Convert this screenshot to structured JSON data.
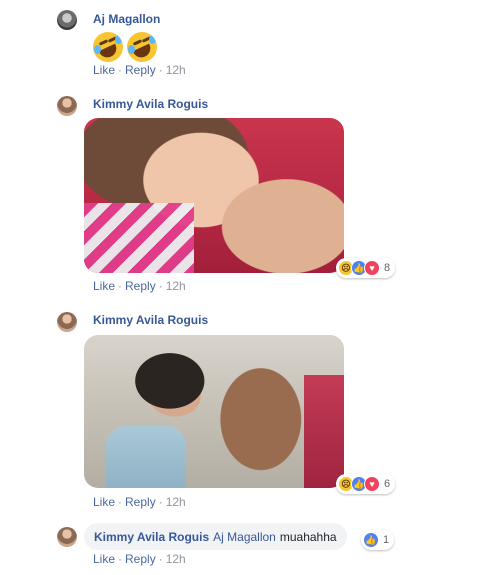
{
  "comments": [
    {
      "author": "Aj Magallon",
      "emojis": [
        "rolling-on-floor-laughing",
        "rolling-on-floor-laughing"
      ],
      "like": "Like",
      "reply": "Reply",
      "time": "12h"
    },
    {
      "author": "Kimmy Avila Roguis",
      "photo": "selfie-photo-1",
      "reactions": [
        "sad",
        "like",
        "love"
      ],
      "reaction_count": "8",
      "like": "Like",
      "reply": "Reply",
      "time": "12h"
    },
    {
      "author": "Kimmy Avila Roguis",
      "photo": "selfie-photo-2",
      "reactions": [
        "sad",
        "like",
        "love"
      ],
      "reaction_count": "6",
      "like": "Like",
      "reply": "Reply",
      "time": "12h"
    },
    {
      "author": "Kimmy Avila Roguis",
      "tag": "Aj Magallon",
      "text": "muahahha",
      "reactions": [
        "like"
      ],
      "reaction_count": "1",
      "like": "Like",
      "reply": "Reply",
      "time": "12h"
    }
  ],
  "separator": "·",
  "colors": {
    "name": "#385898",
    "link": "#4b67a1",
    "meta": "#90949c",
    "bubble": "#f2f3f5",
    "like": "#4e82f2",
    "love": "#f0425c",
    "sad": "#f7c532"
  }
}
